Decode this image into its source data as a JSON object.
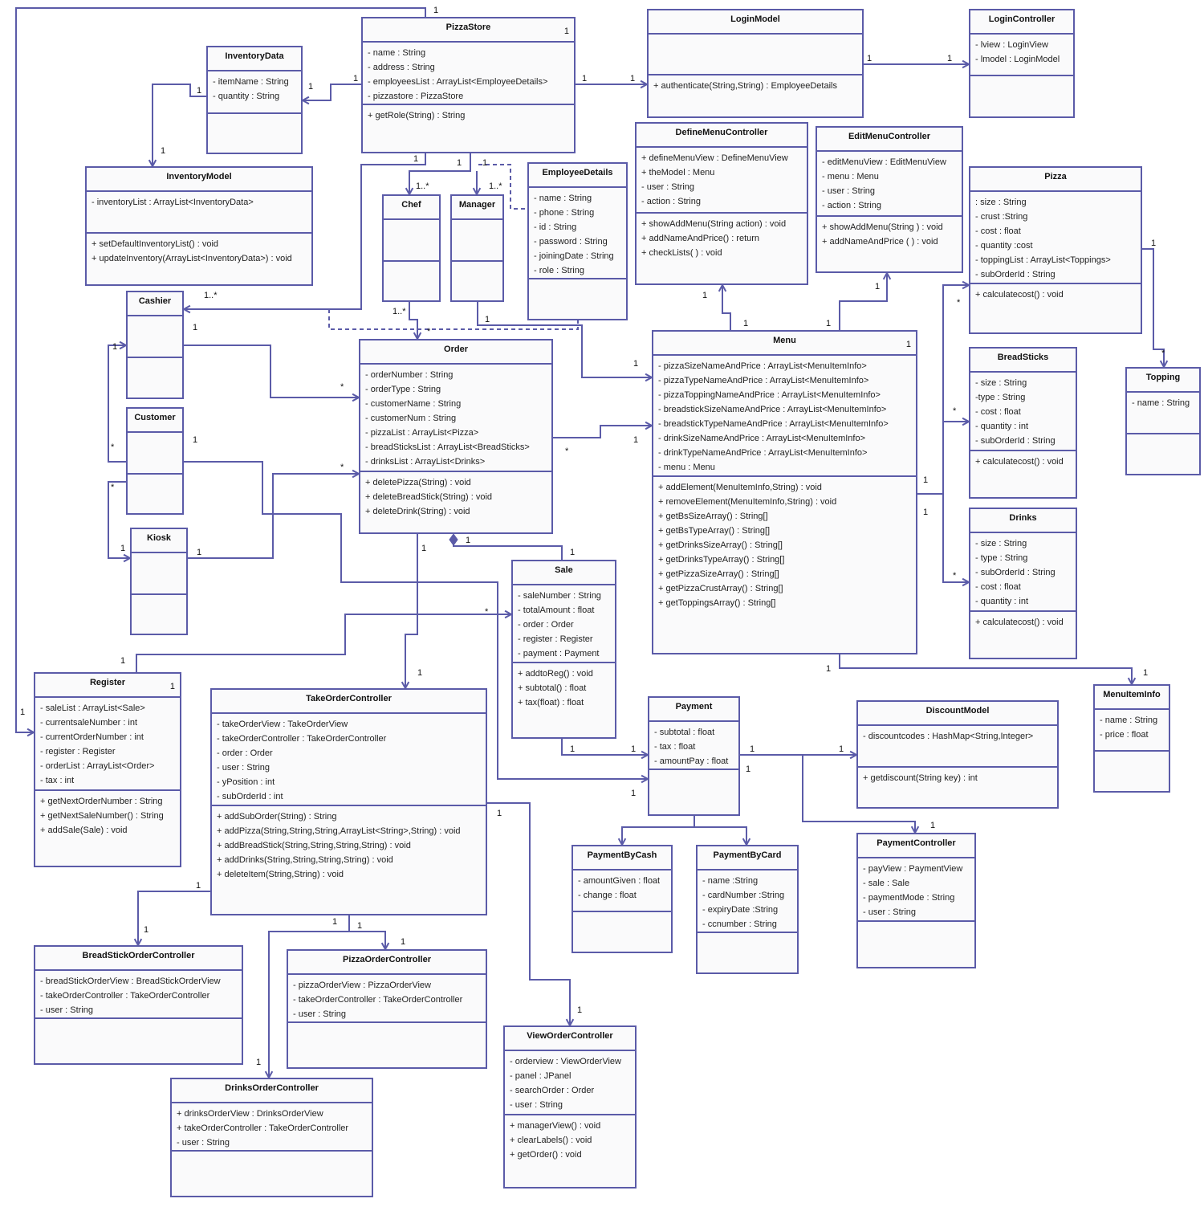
{
  "diagram": {
    "line_color": "#5b5ba8",
    "box_fill": "#fafafb",
    "classes": [
      {
        "name": "PizzaStore",
        "corner": "1",
        "attributes": [
          "- name : String",
          "- address : String",
          "- employeesList : ArrayList<EmployeeDetails>",
          "- pizzastore : PizzaStore"
        ],
        "methods": [
          "+ getRole(String) : String"
        ]
      },
      {
        "name": "InventoryData",
        "attributes": [
          "- itemName : String",
          "- quantity : String"
        ],
        "methods": []
      },
      {
        "name": "LoginModel",
        "attributes": [],
        "methods": [
          "+ authenticate(String,String) : EmployeeDetails"
        ]
      },
      {
        "name": "LoginController",
        "attributes": [
          "- lview : LoginView",
          "- lmodel : LoginModel"
        ],
        "methods": []
      },
      {
        "name": "InventoryModel",
        "attributes": [
          "- inventoryList : ArrayList<InventoryData>"
        ],
        "methods": [
          "+ setDefaultInventoryList() : void",
          "+ updateInventory(ArrayList<InventoryData>) : void"
        ]
      },
      {
        "name": "DefineMenuController",
        "attributes": [
          "+ defineMenuView : DefineMenuView",
          "+ theModel : Menu",
          "- user : String",
          "- action : String"
        ],
        "methods": [
          "+ showAddMenu(String action) : void",
          "+ addNameAndPrice() : return",
          "+ checkLists( ) : void"
        ]
      },
      {
        "name": "EditMenuController",
        "attributes": [
          "- editMenuView : EditMenuView",
          "- menu : Menu",
          "- user : String",
          "- action : String"
        ],
        "methods": [
          "+ showAddMenu(String ) : void",
          "+ addNameAndPrice ( ) : void"
        ]
      },
      {
        "name": "Pizza",
        "attributes": [
          ": size : String",
          "- crust :String",
          "- cost : float",
          "- quantity :cost",
          "- toppingList : ArrayList<Toppings>",
          "- subOrderId : String"
        ],
        "methods": [
          "+ calculatecost() : void"
        ]
      },
      {
        "name": "EmployeeDetails",
        "attributes": [
          "- name : String",
          "- phone : String",
          "- id : String",
          "- password : String",
          "- joiningDate : String",
          "- role : String"
        ],
        "methods": []
      },
      {
        "name": "Chef",
        "attributes": [],
        "methods": []
      },
      {
        "name": "Manager",
        "attributes": [],
        "methods": []
      },
      {
        "name": "Cashier",
        "attributes": [],
        "methods": []
      },
      {
        "name": "Order",
        "attributes": [
          "- orderNumber : String",
          "- orderType : String",
          "- customerName : String",
          "- customerNum : String",
          "- pizzaList : ArrayList<Pizza>",
          "- breadSticksList : ArrayList<BreadSticks>",
          "- drinksList : ArrayList<Drinks>"
        ],
        "methods": [
          "+ deletePizza(String) : void",
          "+ deleteBreadStick(String) : void",
          "+ deleteDrink(String) : void"
        ]
      },
      {
        "name": "Menu",
        "corner": "1",
        "attributes": [
          "- pizzaSizeNameAndPrice : ArrayList<MenuItemInfo>",
          "- pizzaTypeNameAndPrice : ArrayList<MenuItemInfo>",
          "- pizzaToppingNameAndPrice : ArrayList<MenuItemInfo>",
          "- breadstickSizeNameAndPrice : ArrayList<MenuItemInfo>",
          "- breadstickTypeNameAndPrice : ArrayList<MenuItemInfo>",
          "- drinkSizeNameAndPrice : ArrayList<MenuItemInfo>",
          "- drinkTypeNameAndPrice : ArrayList<MenuItemInfo>",
          "- menu : Menu"
        ],
        "methods": [
          "+ addElement(MenuItemInfo,String) : void",
          "+ removeElement(MenuItemInfo,String) : void",
          "+ getBsSizeArray() : String[]",
          "+ getBsTypeArray() : String[]",
          "+ getDrinksSizeArray() : String[]",
          "+ getDrinksTypeArray() : String[]",
          "+ getPizzaSizeArray() : String[]",
          "+ getPizzaCrustArray() : String[]",
          "+ getToppingsArray() : String[]"
        ]
      },
      {
        "name": "BreadSticks",
        "attributes": [
          "- size : String",
          "-type : String",
          "- cost : float",
          "- quantity : int",
          "- subOrderId : String"
        ],
        "methods": [
          "+ calculatecost() : void"
        ]
      },
      {
        "name": "Topping",
        "attributes": [
          "- name : String"
        ],
        "methods": []
      },
      {
        "name": "Customer",
        "attributes": [],
        "methods": []
      },
      {
        "name": "Drinks",
        "attributes": [
          "- size : String",
          "- type  : String",
          "- subOrderId : String",
          "- cost : float",
          "- quantity : int"
        ],
        "methods": [
          "+ calculatecost() : void"
        ]
      },
      {
        "name": "Kiosk",
        "attributes": [],
        "methods": []
      },
      {
        "name": "Sale",
        "attributes": [
          "- saleNumber : String",
          "- totalAmount : float",
          "- order : Order",
          "- register : Register",
          "- payment : Payment"
        ],
        "methods": [
          "+ addtoReg() : void",
          "+ subtotal() : float",
          "+ tax(float) : float"
        ]
      },
      {
        "name": "Register",
        "corner": "1",
        "attributes": [
          "- saleList : ArrayList<Sale>",
          "- currentsaleNumber : int",
          "- currentOrderNumber : int",
          "- register : Register",
          "- orderList : ArrayList<Order>",
          "- tax : int"
        ],
        "methods": [
          "+ getNextOrderNumber : String",
          "+ getNextSaleNumber() : String",
          "+ addSale(Sale) : void"
        ]
      },
      {
        "name": "TakeOrderController",
        "attributes": [
          "- takeOrderView : TakeOrderView",
          "- takeOrderController : TakeOrderController",
          "- order : Order",
          "- user : String",
          "- yPosition : int",
          "- subOrderId : int"
        ],
        "methods": [
          "+ addSubOrder(String) : String",
          "+ addPizza(String,String,String,ArrayList<String>,String) : void",
          "+ addBreadStick(String,String,String,String) : void",
          "+ addDrinks(String,String,String,String) : void",
          "+ deleteItem(String,String) : void"
        ]
      },
      {
        "name": "Payment",
        "attributes": [
          "- subtotal : float",
          "- tax : float",
          "- amountPay : float"
        ],
        "methods": []
      },
      {
        "name": "DiscountModel",
        "attributes": [
          "- discountcodes : HashMap<String,Integer>"
        ],
        "methods": [
          "+ getdiscount(String key) : int"
        ]
      },
      {
        "name": "MenuItemInfo",
        "attributes": [
          "- name : String",
          "- price : float"
        ],
        "methods": []
      },
      {
        "name": "PaymentByCash",
        "attributes": [
          "- amountGiven : float",
          "- change : float"
        ],
        "methods": []
      },
      {
        "name": "PaymentByCard",
        "attributes": [
          "- name :String",
          "- cardNumber :String",
          "- expiryDate :String",
          "- ccnumber : String"
        ],
        "methods": []
      },
      {
        "name": "PaymentController",
        "attributes": [
          "- payView : PaymentView",
          "- sale : Sale",
          "- paymentMode : String",
          "- user : String"
        ],
        "methods": []
      },
      {
        "name": "BreadStickOrderController",
        "attributes": [
          "- breadStickOrderView : BreadStickOrderView",
          "- takeOrderController : TakeOrderController",
          "- user : String"
        ],
        "methods": []
      },
      {
        "name": "PizzaOrderController",
        "attributes": [
          "- pizzaOrderView : PizzaOrderView",
          "- takeOrderController : TakeOrderController",
          "- user : String"
        ],
        "methods": []
      },
      {
        "name": "DrinksOrderController",
        "attributes": [
          "+ drinksOrderView : DrinksOrderView",
          "+ takeOrderController : TakeOrderController",
          "- user : String"
        ],
        "methods": []
      },
      {
        "name": "ViewOrderController",
        "attributes": [
          "- orderview : ViewOrderView",
          "- panel : JPanel",
          "- searchOrder : Order",
          "- user : String"
        ],
        "methods": [
          "+ managerView() : void",
          "+ clearLabels() : void",
          "+ getOrder() : void"
        ]
      }
    ],
    "associations": [
      {
        "from": "PizzaStore",
        "to": "Register",
        "labels": [
          "1",
          "1"
        ]
      },
      {
        "from": "PizzaStore",
        "to": "InventoryData",
        "labels": [
          "1",
          "1"
        ]
      },
      {
        "from": "InventoryData",
        "to": "InventoryModel",
        "labels": [
          "1",
          "1"
        ]
      },
      {
        "from": "PizzaStore",
        "to": "LoginModel",
        "labels": [
          "1",
          "1"
        ]
      },
      {
        "from": "LoginModel",
        "to": "LoginController",
        "labels": [
          "1",
          "1"
        ]
      },
      {
        "from": "PizzaStore",
        "to": "Cashier",
        "labels": [
          "1",
          "1..*"
        ]
      },
      {
        "from": "PizzaStore",
        "to": "Chef",
        "labels": [
          "1",
          "1..*"
        ]
      },
      {
        "from": "PizzaStore",
        "to": "Manager",
        "labels": [
          "1..*"
        ]
      },
      {
        "from": "PizzaStore",
        "to": "EmployeeDetails",
        "dashed": true,
        "labels": [
          "1"
        ]
      },
      {
        "from": "Cashier",
        "to": "EmployeeDetails",
        "dashed": true,
        "labels": []
      },
      {
        "from": "Chef",
        "to": "Order",
        "labels": [
          "1..*",
          "*"
        ]
      },
      {
        "from": "Manager",
        "to": "Menu",
        "labels": [
          "1",
          "1"
        ]
      },
      {
        "from": "Cashier",
        "to": "Order",
        "labels": [
          "1",
          "*"
        ]
      },
      {
        "from": "Customer",
        "to": "Payment",
        "labels": [
          "1",
          "1"
        ]
      },
      {
        "from": "Customer",
        "to": "Cashier",
        "labels": [
          "1",
          "*"
        ]
      },
      {
        "from": "Customer",
        "to": "Kiosk",
        "labels": [
          "*",
          "1"
        ]
      },
      {
        "from": "Kiosk",
        "to": "Order",
        "labels": [
          "1",
          "*"
        ]
      },
      {
        "from": "Order",
        "to": "Menu",
        "labels": [
          "*",
          "1"
        ]
      },
      {
        "from": "Order",
        "to": "Sale",
        "aggregation": true,
        "labels": [
          "1",
          "1"
        ]
      },
      {
        "from": "Order",
        "to": "TakeOrderController",
        "labels": [
          "1",
          "1"
        ]
      },
      {
        "from": "Register",
        "to": "Sale",
        "labels": [
          "1",
          "*"
        ]
      },
      {
        "from": "Sale",
        "to": "Payment",
        "labels": [
          "1",
          "1"
        ]
      },
      {
        "from": "Menu",
        "to": "DefineMenuController",
        "labels": [
          "1",
          "1"
        ]
      },
      {
        "from": "Menu",
        "to": "EditMenuController",
        "labels": [
          "1",
          "1"
        ]
      },
      {
        "from": "Menu",
        "to": "Pizza",
        "labels": [
          "1",
          "*"
        ]
      },
      {
        "from": "Menu",
        "to": "BreadSticks",
        "labels": [
          "*"
        ]
      },
      {
        "from": "Menu",
        "to": "Drinks",
        "labels": [
          "1",
          "*"
        ]
      },
      {
        "from": "Pizza",
        "to": "Topping",
        "labels": [
          "1",
          "*"
        ]
      },
      {
        "from": "Menu",
        "to": "MenuItemInfo",
        "labels": [
          "1",
          "1"
        ]
      },
      {
        "from": "Payment",
        "to": "DiscountModel",
        "labels": [
          "1",
          "1"
        ]
      },
      {
        "from": "Payment",
        "to": "PaymentController",
        "labels": [
          "1",
          "1"
        ]
      },
      {
        "from": "Payment",
        "to": "PaymentByCash",
        "labels": []
      },
      {
        "from": "Payment",
        "to": "PaymentByCard",
        "labels": []
      },
      {
        "from": "TakeOrderController",
        "to": "BreadStickOrderController",
        "labels": [
          "1",
          "1"
        ]
      },
      {
        "from": "TakeOrderController",
        "to": "PizzaOrderController",
        "labels": [
          "1",
          "1",
          "1"
        ]
      },
      {
        "from": "TakeOrderController",
        "to": "DrinksOrderController",
        "labels": [
          "1"
        ]
      },
      {
        "from": "TakeOrderController",
        "to": "ViewOrderController",
        "labels": [
          "1",
          "1"
        ]
      }
    ]
  }
}
